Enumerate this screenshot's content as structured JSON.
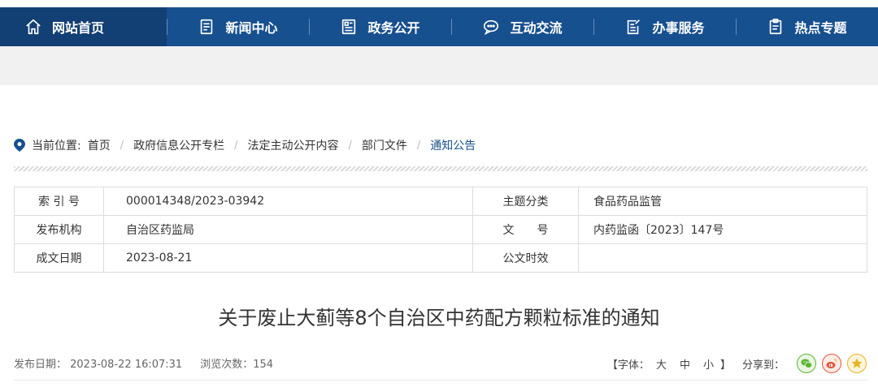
{
  "nav": [
    {
      "label": "网站首页",
      "icon": "home-icon"
    },
    {
      "label": "新闻中心",
      "icon": "news-icon"
    },
    {
      "label": "政务公开",
      "icon": "document-icon"
    },
    {
      "label": "互动交流",
      "icon": "chat-icon"
    },
    {
      "label": "办事服务",
      "icon": "edit-icon"
    },
    {
      "label": "热点专题",
      "icon": "clipboard-icon"
    }
  ],
  "breadcrumb": {
    "label": "当前位置:",
    "items": [
      "首页",
      "政府信息公开专栏",
      "法定主动公开内容",
      "部门文件",
      "通知公告"
    ]
  },
  "info": {
    "rows": [
      {
        "k1": "索 引 号",
        "v1": "000014348/2023-03942",
        "k2": "主题分类",
        "v2": "食品药品监管"
      },
      {
        "k1": "发布机构",
        "v1": "自治区药监局",
        "k2": "文　　号",
        "v2": "内药监函〔2023〕147号"
      },
      {
        "k1": "成文日期",
        "v1": "2023-08-21",
        "k2": "公文时效",
        "v2": ""
      }
    ]
  },
  "article": {
    "title": "关于废止大蓟等8个自治区中药配方颗粒标准的通知",
    "publish_date": "发布日期： 2023-08-22 16:07:31",
    "views": "浏览次数：154"
  },
  "tools": {
    "font_prefix": "【字体：",
    "font_large": "大",
    "font_medium": "中",
    "font_small": "小",
    "font_suffix": "】",
    "share_label": "分享到：",
    "share_icons": [
      "wechat-icon",
      "weibo-icon",
      "qzone-icon"
    ]
  },
  "colors": {
    "nav_bg": "#17508f",
    "nav_active": "#123f74",
    "link": "#17508f"
  }
}
